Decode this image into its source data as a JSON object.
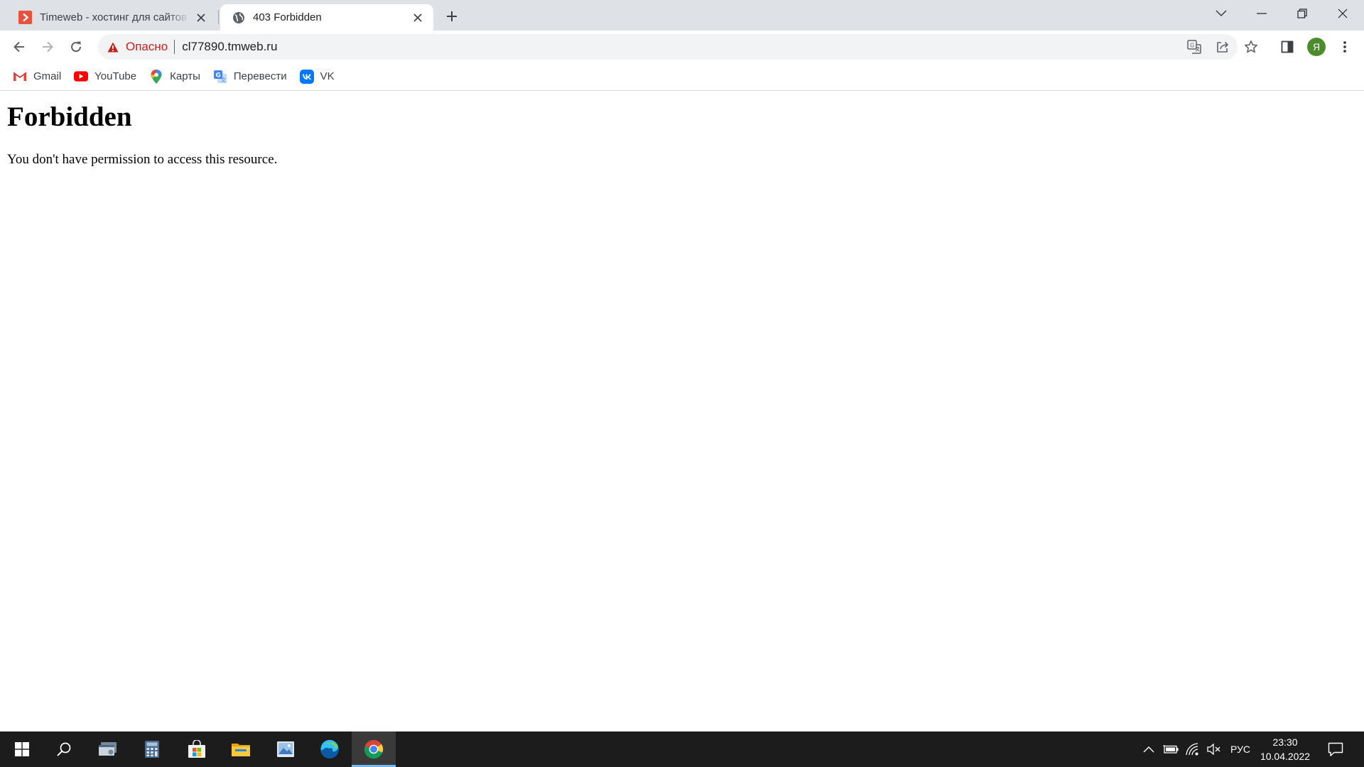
{
  "browser": {
    "tabs": [
      {
        "title": "Timeweb - хостинг для сайтов и",
        "active": false,
        "favicon": "timeweb-logo-icon"
      },
      {
        "title": "403 Forbidden",
        "active": true,
        "favicon": "globe-icon"
      }
    ],
    "address_bar": {
      "security_label": "Опасно",
      "url": "cl77890.tmweb.ru"
    },
    "profile_initial": "Я",
    "bookmarks": [
      {
        "label": "Gmail",
        "icon": "gmail-icon"
      },
      {
        "label": "YouTube",
        "icon": "youtube-icon"
      },
      {
        "label": "Карты",
        "icon": "maps-pin-icon"
      },
      {
        "label": "Перевести",
        "icon": "translate-icon"
      },
      {
        "label": "VK",
        "icon": "vk-icon"
      }
    ]
  },
  "page": {
    "heading": "Forbidden",
    "message": "You don't have permission to access this resource."
  },
  "taskbar": {
    "apps": [
      "start",
      "search",
      "app-window",
      "calculator",
      "microsoft-store",
      "file-explorer",
      "photos",
      "edge",
      "chrome"
    ],
    "active_app": "chrome",
    "language": "РУС",
    "time": "23:30",
    "date": "10.04.2022"
  },
  "colors": {
    "tab_strip": "#dee1e6",
    "danger": "#c5221f",
    "taskbar": "#1c1c1c",
    "avatar": "#4c8c2b"
  }
}
